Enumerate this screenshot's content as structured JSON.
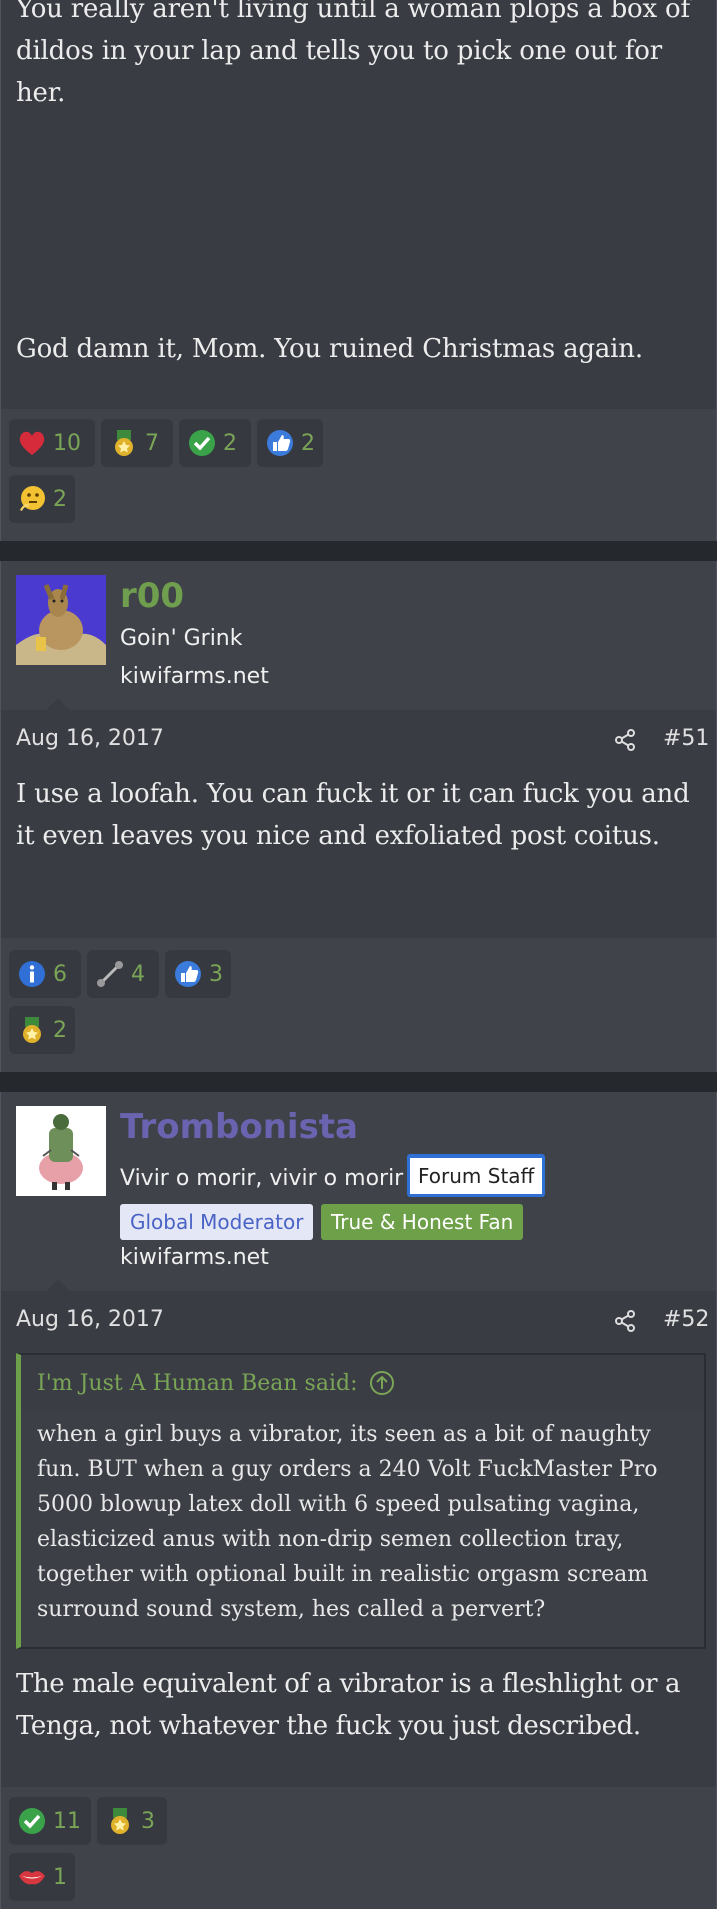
{
  "post50": {
    "body_top": "You really aren't living until a woman plops a box of dildos in your lap and tells you to pick one out for her.",
    "body_bottom": "God damn it, Mom. You ruined Christmas again.",
    "reactions": [
      {
        "icon": "heart-icon",
        "count": "10"
      },
      {
        "icon": "medal-icon",
        "count": "7"
      },
      {
        "icon": "check-icon",
        "count": "2"
      },
      {
        "icon": "thumbs-up-icon",
        "count": "2"
      },
      {
        "icon": "thinking-icon",
        "count": "2"
      }
    ]
  },
  "post51": {
    "username": "r00",
    "user_title": "Goin' Grink",
    "site": "kiwifarms.net",
    "date": "Aug 16, 2017",
    "post_number": "#51",
    "body": "I use a loofah. You can fuck it or it can fuck you and it even leaves you nice and exfoliated post coitus.",
    "reactions": [
      {
        "icon": "info-icon",
        "count": "6"
      },
      {
        "icon": "dumbbell-icon",
        "count": "4"
      },
      {
        "icon": "thumbs-up-icon",
        "count": "3"
      },
      {
        "icon": "medal-icon",
        "count": "2"
      }
    ]
  },
  "post52": {
    "username": "Trombonista",
    "user_title": "Vivir o morir, vivir o morir",
    "badge_staff": "Forum Staff",
    "badge_mod": "Global Moderator",
    "badge_fan": "True & Honest Fan",
    "site": "kiwifarms.net",
    "date": "Aug 16, 2017",
    "post_number": "#52",
    "quote_author": "I'm Just A Human Bean said:",
    "quote_body": "when a girl buys a vibrator, its seen as a bit of naughty fun. BUT when a guy orders a 240 Volt FuckMaster Pro 5000 blowup latex doll with 6 speed pulsating vagina, elasticized anus with non-drip semen collection tray, together with optional built in realistic orgasm scream surround sound system, hes called a pervert?",
    "body": "The male equivalent of a vibrator is a fleshlight or a Tenga, not whatever the fuck you just described.",
    "reactions": [
      {
        "icon": "check-icon",
        "count": "11"
      },
      {
        "icon": "medal-icon",
        "count": "3"
      },
      {
        "icon": "lips-icon",
        "count": "1"
      }
    ]
  },
  "colors": {
    "accent_green": "#7aa556",
    "username_green": "#6f9e4e",
    "username_purple": "#6a64b0",
    "quote_bar": "#6ea04a"
  }
}
